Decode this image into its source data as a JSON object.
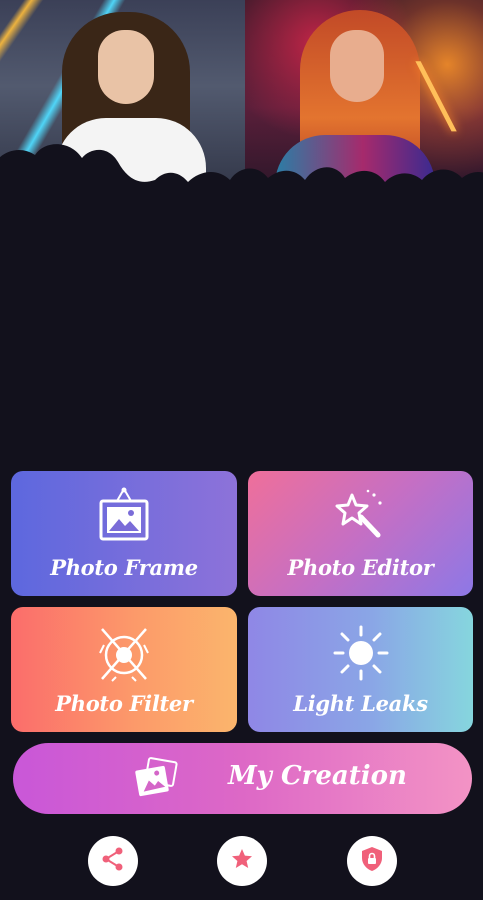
{
  "tiles": {
    "photo_frame": {
      "label": "Photo Frame",
      "icon": "picture-frame-icon"
    },
    "photo_editor": {
      "label": "Photo Editor",
      "icon": "magic-wand-icon"
    },
    "photo_filter": {
      "label": "Photo Filter",
      "icon": "filter-lens-icon"
    },
    "light_leaks": {
      "label": "Light Leaks",
      "icon": "sun-icon"
    }
  },
  "my_creation": {
    "label": "My Creation",
    "icon": "photo-stack-icon"
  },
  "bottom_buttons": [
    {
      "icon": "share-icon"
    },
    {
      "icon": "star-icon"
    },
    {
      "icon": "privacy-shield-icon"
    }
  ],
  "colors": {
    "background": "#12111c",
    "bottom_icon": "#f0607a"
  }
}
